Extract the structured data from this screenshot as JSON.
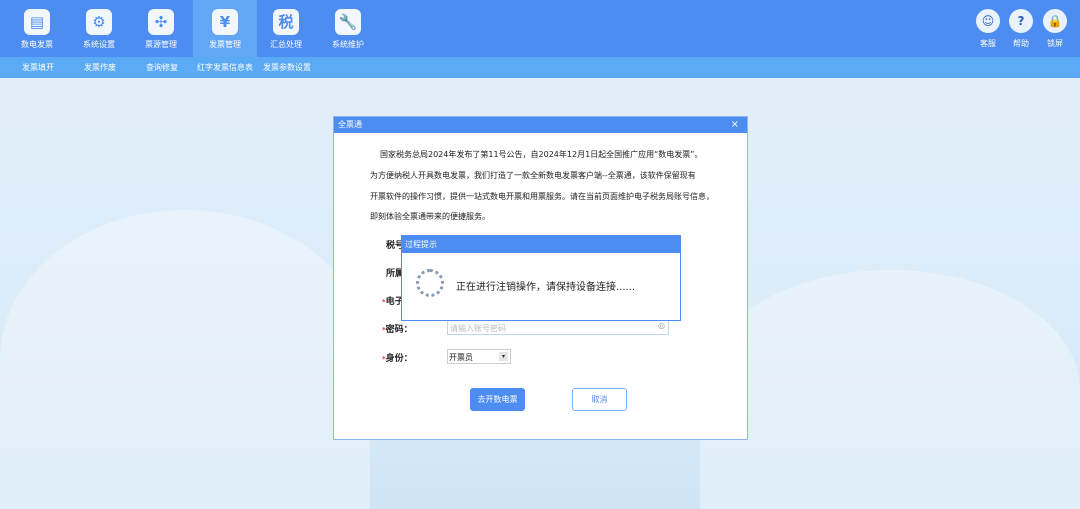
{
  "nav": [
    {
      "label": "数电发票",
      "icon": "invoice-printer-icon"
    },
    {
      "label": "系统设置",
      "icon": "gear-icon"
    },
    {
      "label": "票源管理",
      "icon": "network-icon"
    },
    {
      "label": "发票管理",
      "icon": "invoice-yen-icon",
      "active": true
    },
    {
      "label": "汇总处理",
      "icon": "tax-hand-icon"
    },
    {
      "label": "系统维护",
      "icon": "wrench-icon"
    }
  ],
  "subnav": [
    "发票填开",
    "发票作废",
    "查询修复",
    "红字发票信息表",
    "发票参数设置"
  ],
  "right": [
    {
      "label": "客服",
      "icon": "robot-icon"
    },
    {
      "label": "帮助",
      "icon": "help-book-icon"
    },
    {
      "label": "锁屏",
      "icon": "lock-icon"
    }
  ],
  "dialog": {
    "title": "全票通",
    "close": "×",
    "paragraphs": [
      "国家税务总局2024年发布了第11号公告，自2024年12月1日起全国推广应用“数电发票”。",
      "为方便纳税人开具数电发票，我们打造了一款全新数电发票客户端--全票通，该软件保留现有",
      "开票软件的操作习惯，提供一站式数电开票和用票服务。请在当前页面维护电子税务局账号信息，",
      "即刻体验全票通带来的便捷服务。"
    ],
    "fields": {
      "tax_no": "税号",
      "belong": "所属",
      "phone": "电子",
      "password": "密码：",
      "role": "身份："
    },
    "password_placeholder": "请输入账号密码",
    "role_value": "开票员",
    "confirm": "去开数电票",
    "cancel": "取消"
  },
  "popup": {
    "title": "过程提示",
    "message": "正在进行注销操作，请保持设备连接......"
  }
}
